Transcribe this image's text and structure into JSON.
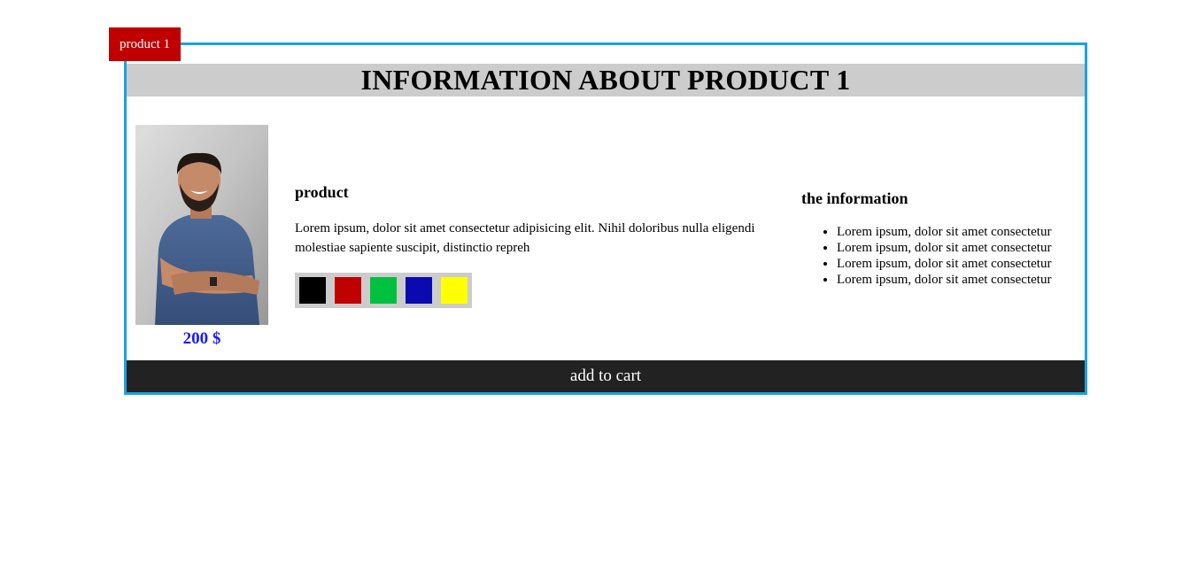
{
  "tag": {
    "label": "product 1"
  },
  "header": {
    "title": "INFORMATION ABOUT PRODUCT 1"
  },
  "product": {
    "price": "200 $",
    "heading": "product",
    "description": "Lorem ipsum, dolor sit amet consectetur adipisicing elit. Nihil doloribus nulla eligendi molestiae sapiente suscipit, distinctio repreh",
    "colors": [
      "#000000",
      "#c00000",
      "#00c040",
      "#0a0ab0",
      "#ffff00"
    ]
  },
  "info": {
    "heading": "the information",
    "items": [
      "Lorem ipsum, dolor sit amet consectetur",
      "Lorem ipsum, dolor sit amet consectetur",
      "Lorem ipsum, dolor sit amet consectetur",
      "Lorem ipsum, dolor sit amet consectetur"
    ]
  },
  "cart": {
    "button_label": "add to cart"
  },
  "theme": {
    "border_color": "#1aa3e0",
    "tag_color": "#c00000",
    "price_color": "#1a1aff",
    "cart_bg": "#222222"
  }
}
